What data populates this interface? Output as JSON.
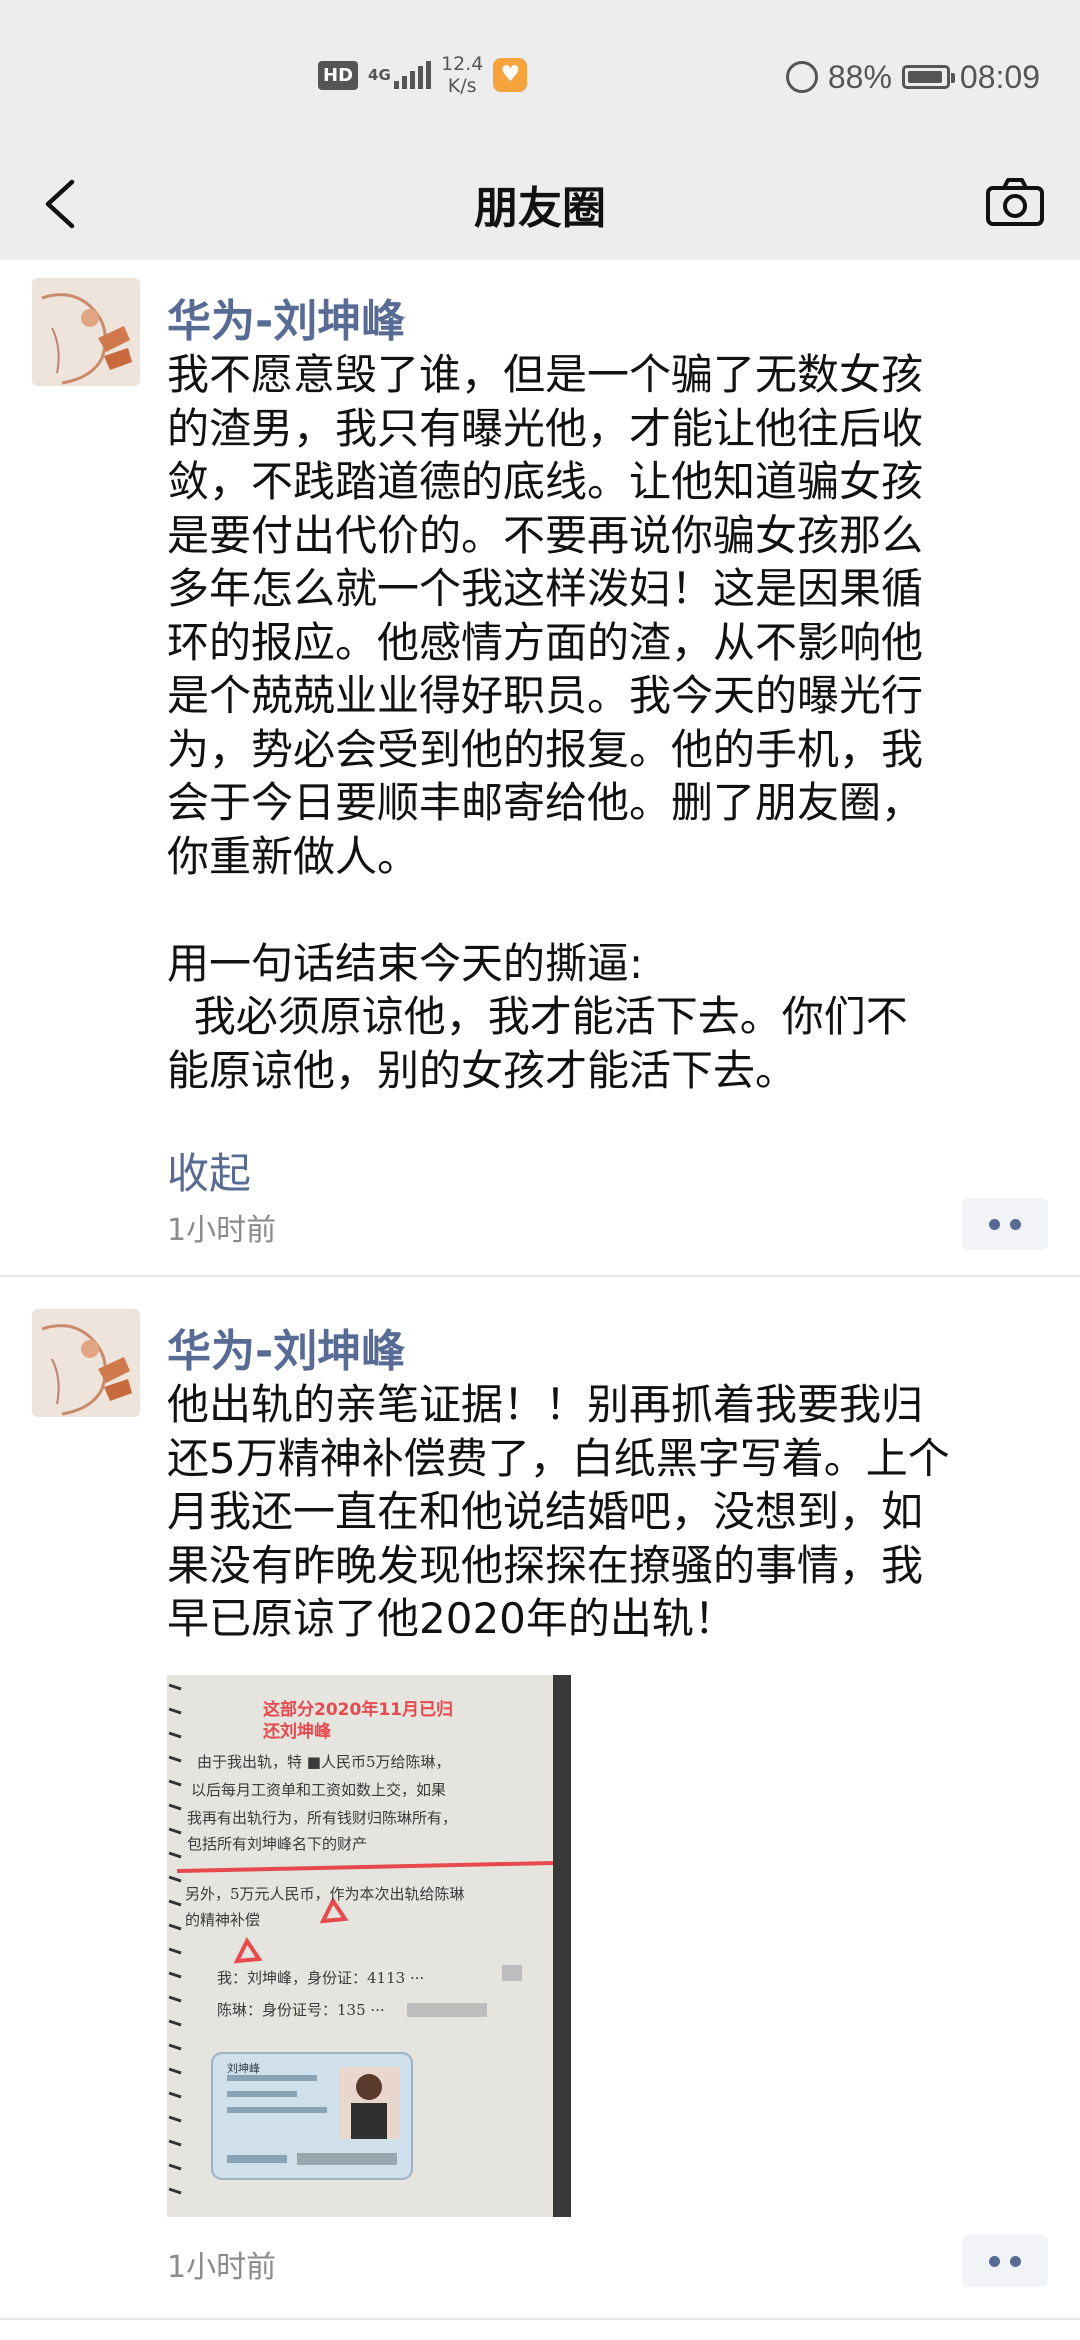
{
  "status_bar": {
    "hd_badge": "HD",
    "network": "4G",
    "speed_value": "12.4",
    "speed_unit": "K/s",
    "battery": "88%",
    "time": "08:09"
  },
  "nav": {
    "title": "朋友圈"
  },
  "posts": [
    {
      "author": "华为-刘坤峰",
      "text": "我不愿意毁了谁，但是一个骗了无数女孩\n的渣男，我只有曝光他，才能让他往后收\n敛，不践踏道德的底线。让他知道骗女孩\n是要付出代价的。不要再说你骗女孩那么\n多年怎么就一个我这样泼妇！这是因果循\n环的报应。他感情方面的渣，从不影响他\n是个兢兢业业得好职员。我今天的曝光行\n为，势必会受到他的报复。他的手机，我\n会于今日要顺丰邮寄给他。删了朋友圈，\n你重新做人。\n\n用一句话结束今天的撕逼:\n  我必须原谅他，我才能活下去。你们不\n能原谅他，别的女孩才能活下去。",
      "collapse_label": "收起",
      "time": "1小时前"
    },
    {
      "author": "华为-刘坤峰",
      "text": "他出轨的亲笔证据！！别再抓着我要我归\n还5万精神补偿费了，白纸黑字写着。上个\n月我还一直在和他说结婚吧，没想到，如\n果没有昨晚发现他探探在撩骚的事情，我\n早已原谅了他2020年的出轨！",
      "photo": {
        "header_line1": "这部分2020年11月已归",
        "header_line2": "还刘坤峰",
        "lines": [
          "由于我出轨，特 ■人民币5万给陈琳，",
          "以后每月工资单和工资如数上交，如果",
          "我再有出轨行为，所有钱财归陈琳所有，",
          "包括所有刘坤峰名下的财产",
          "另外，5万元人民币，作为本次出轨给陈琳",
          "的精神补偿",
          "我：刘坤峰，身份证：4113 ···",
          "陈琳：身份证号：135 ···"
        ],
        "id_card_name": "刘坤峰"
      },
      "time": "1小时前"
    }
  ],
  "colors": {
    "link_blue": "#576b95",
    "bar_bg": "#ededed",
    "red_annotation": "#e8494d"
  }
}
